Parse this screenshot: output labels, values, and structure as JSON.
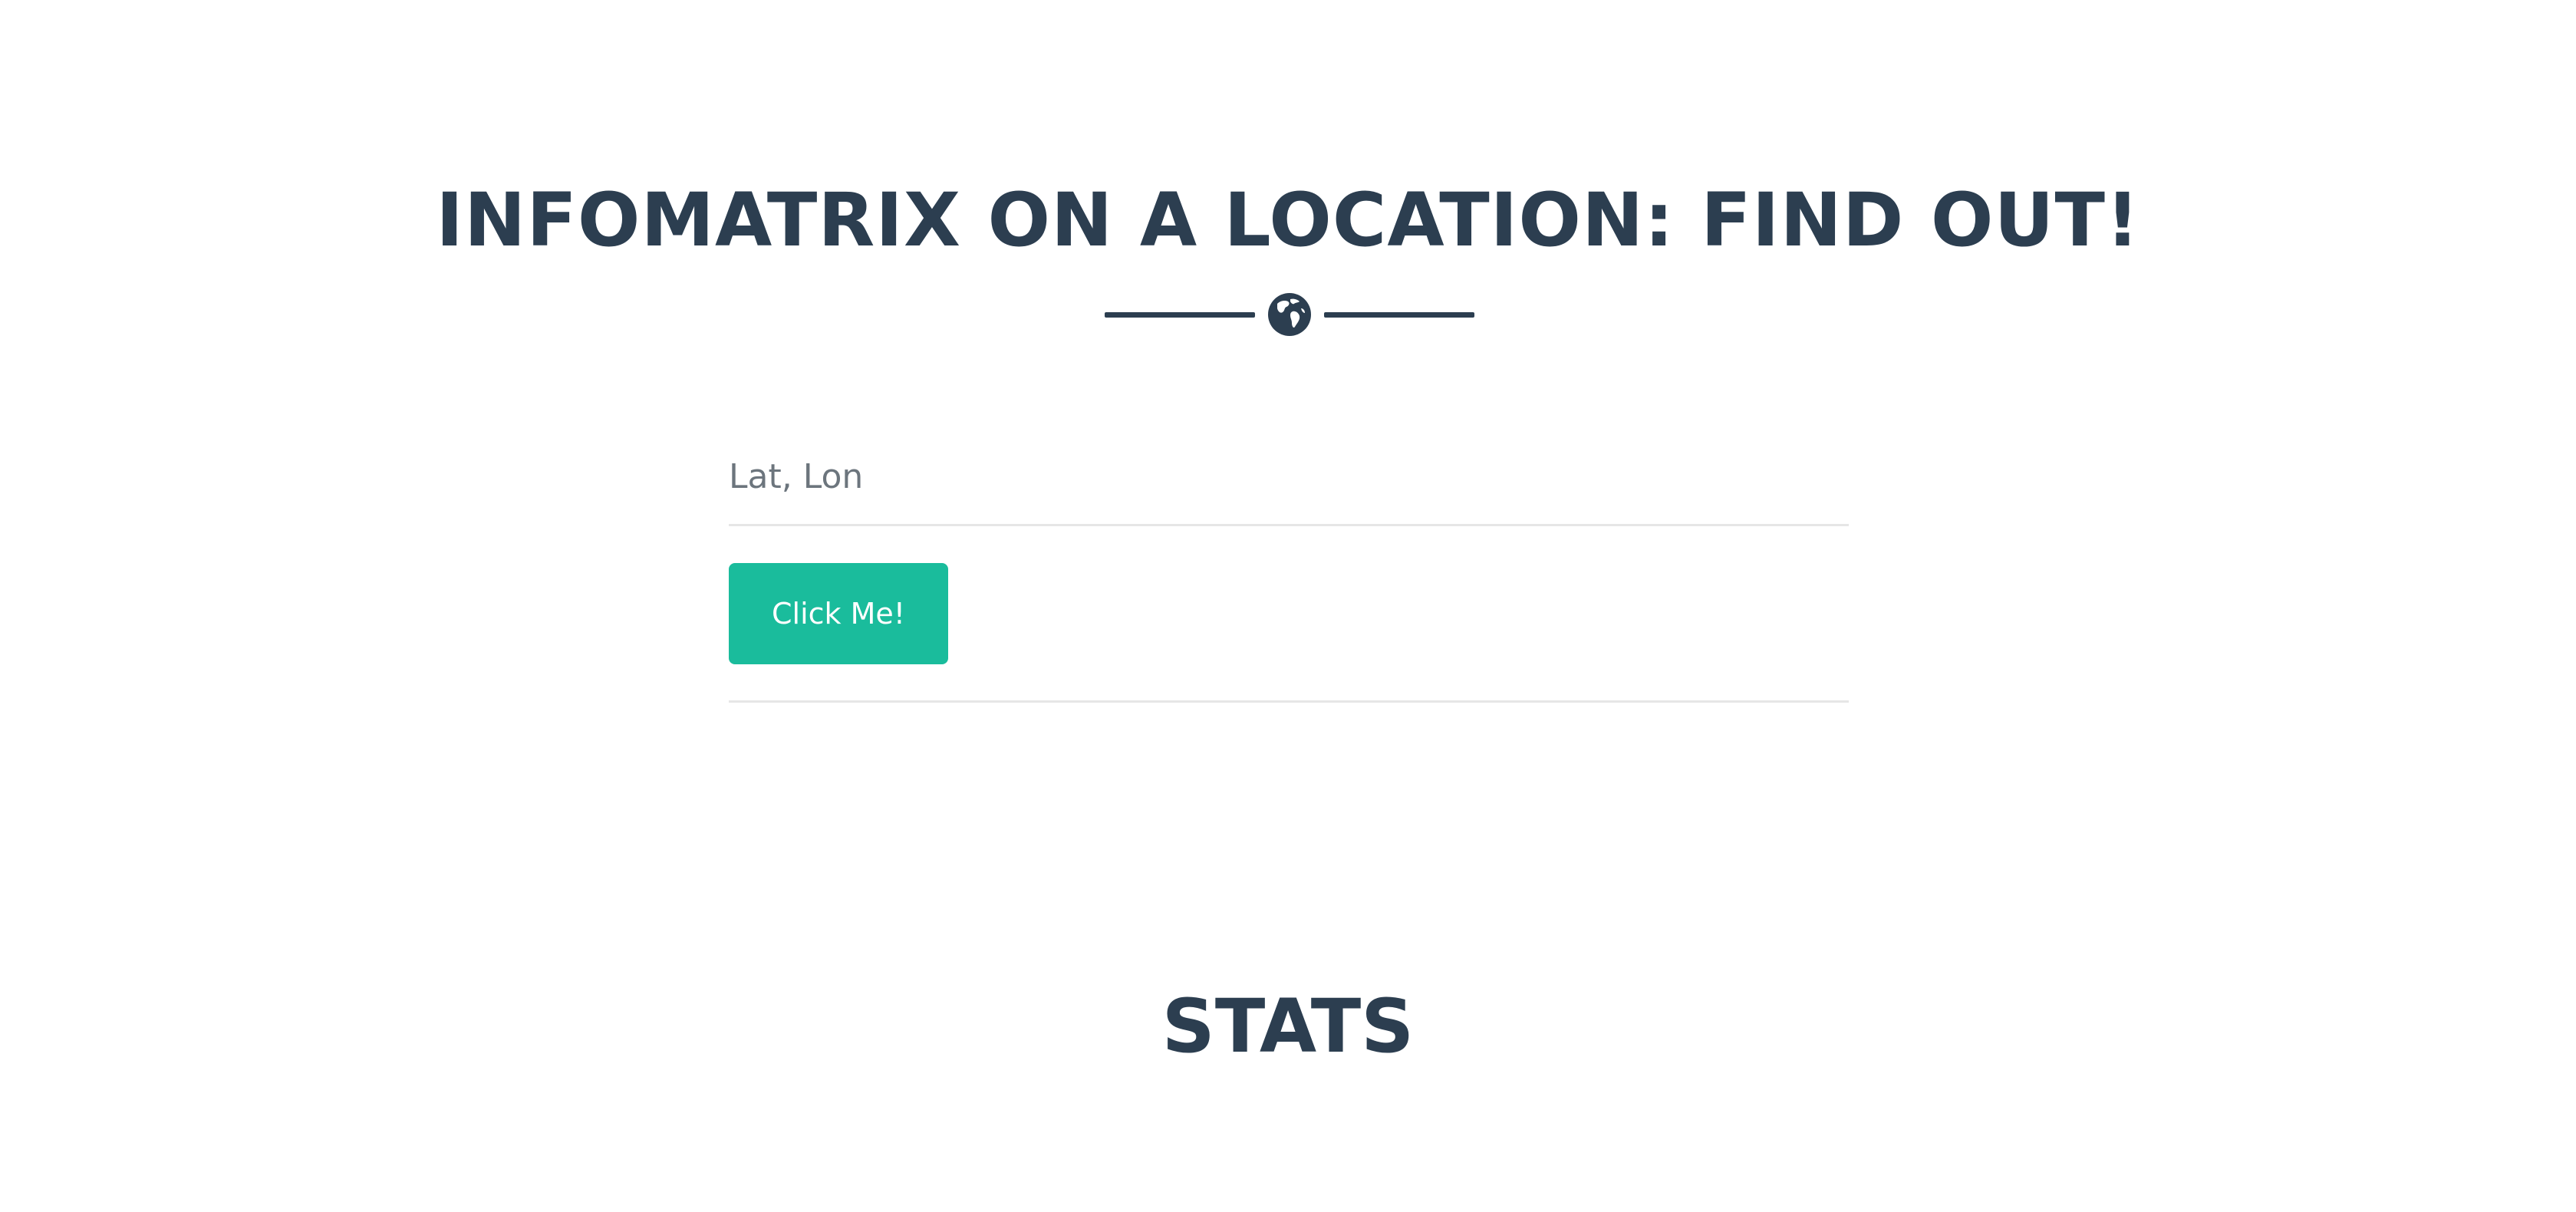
{
  "header": {
    "title": "INFOMATRIX ON A LOCATION: FIND OUT!",
    "divider_icon": "globe-icon"
  },
  "form": {
    "input_placeholder": "Lat, Lon",
    "input_value": "",
    "submit_label": "Click Me!"
  },
  "stats": {
    "title": "STATS"
  },
  "colors": {
    "text_primary": "#2c3e50",
    "accent": "#1abc9c",
    "button_text": "#ffffff",
    "rule": "#e6e6e6",
    "placeholder": "#6c757d"
  }
}
